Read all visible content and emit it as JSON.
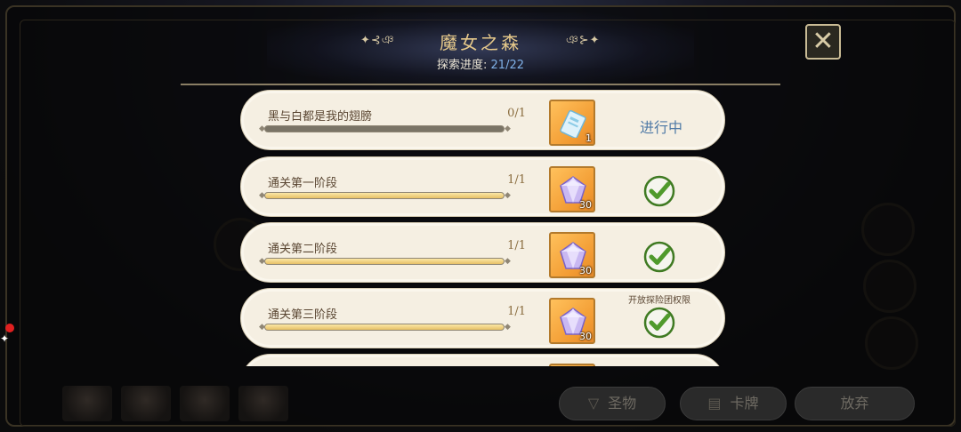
{
  "header": {
    "title": "魔女之森",
    "progress_label": "探索进度:",
    "progress_value": "21/22",
    "deco_left": "✦⊰ঞ",
    "deco_right": "ঞ⊱✦",
    "close_icon": "close-icon"
  },
  "tasks": [
    {
      "name": "黑与白都是我的翅膀",
      "count": "0/1",
      "progress": 0.0,
      "reward_icon": "ticket-icon",
      "reward_qty": "1",
      "status": "进行中",
      "note": ""
    },
    {
      "name": "通关第一阶段",
      "count": "1/1",
      "progress": 1.0,
      "reward_icon": "gem-icon",
      "reward_qty": "30",
      "status": "completed",
      "note": ""
    },
    {
      "name": "通关第二阶段",
      "count": "1/1",
      "progress": 1.0,
      "reward_icon": "gem-icon",
      "reward_qty": "30",
      "status": "completed",
      "note": ""
    },
    {
      "name": "通关第三阶段",
      "count": "1/1",
      "progress": 1.0,
      "reward_icon": "gem-icon",
      "reward_qty": "30",
      "status": "completed",
      "note": "开放探险团权限"
    }
  ],
  "bottom": {
    "relic_label": "圣物",
    "card_label": "卡牌",
    "abandon_label": "放弃"
  },
  "colors": {
    "title": "#e6c98a",
    "progress_value": "#7fb0e6",
    "in_progress": "#4f7aa6",
    "check_green": "#4f9a2c",
    "reward_bg": "#f29b32"
  }
}
